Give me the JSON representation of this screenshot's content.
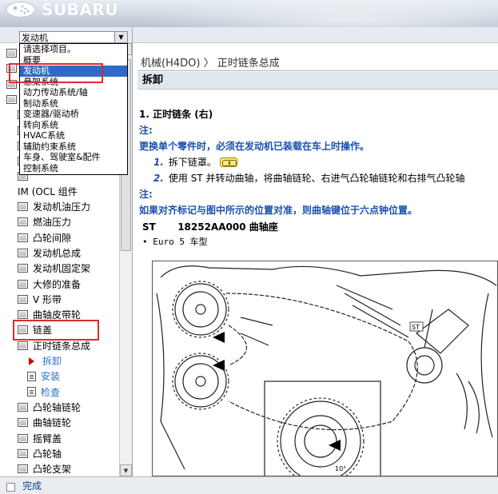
{
  "header": {
    "brand": "SUBARU"
  },
  "nav": {
    "selected_value": "发动机",
    "dropdown_options": [
      "请选择项目。",
      "概要",
      "发动机",
      "悬架系统",
      "动力传动系统/轴",
      "制动系统",
      "变速器/驱动桥",
      "转向系统",
      "HVAC系统",
      "辅助约束系统",
      "车身、驾驶室&配件",
      "控制系统"
    ],
    "selected_index": 2,
    "tree": [
      {
        "label": "发动机油压力",
        "icon": "book"
      },
      {
        "label": "燃油压力",
        "icon": "book"
      },
      {
        "label": "凸轮间隙",
        "icon": "book"
      },
      {
        "label": "发动机总成",
        "icon": "book"
      },
      {
        "label": "发动机固定架",
        "icon": "book"
      },
      {
        "label": "大修的准备",
        "icon": "book"
      },
      {
        "label": "V 形带",
        "icon": "book"
      },
      {
        "label": "曲轴皮带轮",
        "icon": "book"
      },
      {
        "label": "链盖",
        "icon": "book"
      },
      {
        "label": "正时链条总成",
        "icon": "book-open"
      },
      {
        "label": "拆卸",
        "icon": "arrow"
      },
      {
        "label": "安装",
        "icon": "doc"
      },
      {
        "label": "检查",
        "icon": "doc"
      },
      {
        "label": "凸轮轴链轮",
        "icon": "book"
      },
      {
        "label": "曲轴链轮",
        "icon": "book"
      },
      {
        "label": "摇臂盖",
        "icon": "book"
      },
      {
        "label": "凸轮轴",
        "icon": "book"
      },
      {
        "label": "凸轮支架",
        "icon": "book"
      }
    ],
    "partial_top_label": "IM (OCL 组件"
  },
  "content": {
    "breadcrumb": "机械(H4DO) 〉 正时链条总成",
    "section_title": "拆卸",
    "heading": "1.  正时链条 (右)",
    "note1_label": "注:",
    "note1_text": "更换单个零件时，必须在发动机已装载在车上时操作。",
    "step1_num": "1.",
    "step1_text": "拆下链罩。",
    "step2_num": "2.",
    "step2_text": "使用 ST 并转动曲轴，将曲轴链轮、右进气凸轮轴链轮和右排气凸轮轴",
    "note2_label": "注:",
    "note2_text": "如果对齐标记与图中所示的位置对准，则曲轴键位于六点钟位置。",
    "st_code": "ST",
    "st_part": "18252AA000 曲轴座",
    "bullet": "• Euro 5 车型",
    "diagram_labels": {
      "st": "ST",
      "angle": "10°"
    }
  },
  "status": {
    "text": "完成"
  }
}
